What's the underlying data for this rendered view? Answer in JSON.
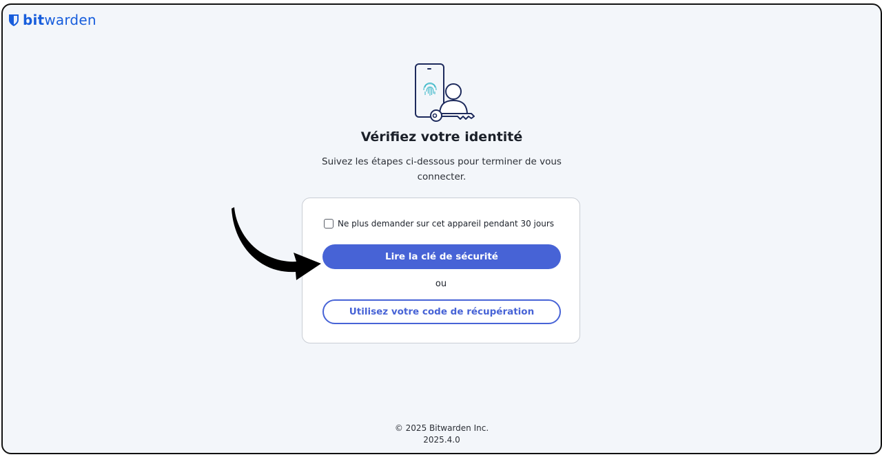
{
  "brand": {
    "logo_icon": "shield-icon",
    "name_bold": "bit",
    "name_regular": "warden",
    "color": "#175ddc"
  },
  "main": {
    "illustration_icon": "phone-fingerprint-user-key-icon",
    "title": "Vérifiez votre identité",
    "subtitle": "Suivez les étapes ci-dessous pour terminer de vous connecter."
  },
  "card": {
    "remember_label": "Ne plus demander sur cet appareil pendant 30 jours",
    "remember_checked": false,
    "primary_button": "Lire la clé de sécurité",
    "or_text": "ou",
    "secondary_button": "Utilisez votre code de récupération"
  },
  "annotation": {
    "arrow_icon": "curved-arrow-icon",
    "arrow_color": "#000000"
  },
  "footer": {
    "copyright": "© 2025 Bitwarden Inc.",
    "version": "2025.4.0"
  },
  "colors": {
    "accent": "#4763d6",
    "background": "#f3f6fa"
  }
}
